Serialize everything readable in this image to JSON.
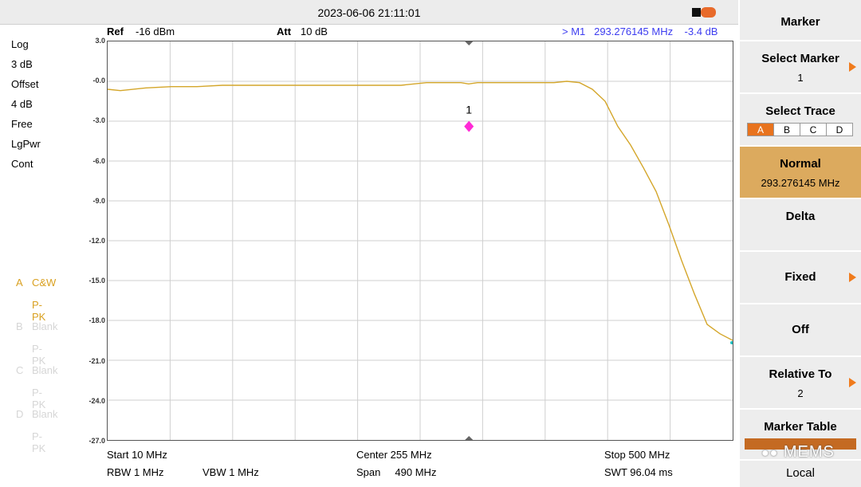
{
  "header": {
    "datetime": "2023-06-06 21:11:01",
    "ref_label": "Ref",
    "ref_value": "-16 dBm",
    "att_label": "Att",
    "att_value": "10 dB",
    "marker_readout": "> M1   293.276145 MHz    -3.4 dB"
  },
  "left_panel": [
    "Log",
    "3 dB",
    "Offset",
    "4 dB",
    "Free",
    "LgPwr",
    "Cont"
  ],
  "traces": [
    {
      "letter": "A",
      "name": "C&W",
      "active": true
    },
    {
      "letter": "",
      "name": "P-PK",
      "active": true
    },
    {
      "letter": "B",
      "name": "Blank",
      "active": false
    },
    {
      "letter": "",
      "name": "P-PK",
      "active": false
    },
    {
      "letter": "C",
      "name": "Blank",
      "active": false
    },
    {
      "letter": "",
      "name": "P-PK",
      "active": false
    },
    {
      "letter": "D",
      "name": "Blank",
      "active": false
    },
    {
      "letter": "",
      "name": "P-PK",
      "active": false
    }
  ],
  "y_ticks": [
    "3.0",
    "-0.0",
    "-3.0",
    "-6.0",
    "-9.0",
    "-12.0",
    "-15.0",
    "-18.0",
    "-21.0",
    "-24.0",
    "-27.0"
  ],
  "marker": {
    "label": "1",
    "freq_mhz": 293.276145,
    "level_db": -3.4
  },
  "chart_data": {
    "type": "line",
    "x_unit": "MHz",
    "xlim": [
      10,
      500
    ],
    "ylim": [
      -27,
      3
    ],
    "y_step": 3,
    "trace_color": "#d4a62a",
    "marker_color": "#ff2bd6",
    "grid": true,
    "x": [
      10,
      20,
      40,
      60,
      80,
      100,
      120,
      140,
      160,
      180,
      200,
      220,
      240,
      250,
      260,
      270,
      280,
      287,
      293,
      300,
      310,
      320,
      330,
      340,
      350,
      360,
      370,
      380,
      390,
      400,
      410,
      420,
      430,
      440,
      450,
      460,
      470,
      480,
      490,
      500
    ],
    "y": [
      -0.6,
      -0.7,
      -0.5,
      -0.4,
      -0.4,
      -0.3,
      -0.3,
      -0.3,
      -0.3,
      -0.3,
      -0.3,
      -0.3,
      -0.3,
      -0.2,
      -0.1,
      -0.1,
      -0.1,
      -0.1,
      -0.2,
      -0.1,
      -0.1,
      -0.1,
      -0.1,
      -0.1,
      -0.1,
      -0.1,
      0.0,
      -0.1,
      -0.6,
      -1.5,
      -3.4,
      -4.8,
      -6.5,
      -8.3,
      -10.8,
      -13.5,
      -16.0,
      -18.3,
      -19.0,
      -19.5
    ]
  },
  "footer": {
    "start": "Start  10 MHz",
    "center": "Center  255 MHz",
    "stop": "Stop  500 MHz",
    "rbw": "RBW  1 MHz",
    "vbw": "VBW  1 MHz",
    "span": "Span     490 MHz",
    "swt": "SWT  96.04 ms"
  },
  "softkeys": {
    "title": "Marker",
    "select_marker": "Select Marker",
    "select_marker_value": "1",
    "select_trace": "Select Trace",
    "trace_options": [
      "A",
      "B",
      "C",
      "D"
    ],
    "normal": "Normal",
    "normal_value": "293.276145 MHz",
    "delta": "Delta",
    "fixed": "Fixed",
    "off": "Off",
    "relative_to": "Relative To",
    "relative_to_value": "2",
    "marker_table": "Marker Table",
    "local": "Local"
  },
  "watermark": "MEMS"
}
